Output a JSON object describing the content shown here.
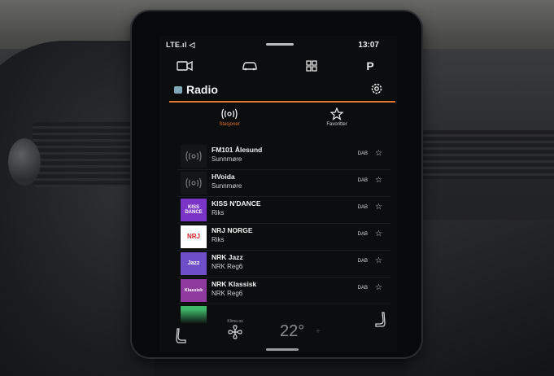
{
  "status": {
    "signal": "LTE.ıl ◁",
    "time": "13:07"
  },
  "topnav": [
    {
      "name": "camera-icon"
    },
    {
      "name": "car-icon"
    },
    {
      "name": "apps-grid-icon"
    },
    {
      "name": "parking-icon",
      "label": "P"
    }
  ],
  "app": {
    "title": "Radio",
    "accent": "#e0742c"
  },
  "tabs": {
    "stations": "Stasjoner",
    "favorites": "Favoritter"
  },
  "stations": [
    {
      "name": "FM101 Ålesund",
      "region": "Sunnmøre",
      "band": "DAB",
      "logo": "generic-radio-icon"
    },
    {
      "name": "HVoida",
      "region": "Sunnmøre",
      "band": "DAB",
      "logo": "generic-radio-icon"
    },
    {
      "name": "KISS N'DANCE",
      "region": "Riks",
      "band": "DAB",
      "logo": "kiss-logo",
      "logo_color": "#7b35c6",
      "logo_text": "KISS DANCE"
    },
    {
      "name": "NRJ NORGE",
      "region": "Riks",
      "band": "DAB",
      "logo": "nrj-logo",
      "logo_color": "#ffffff",
      "logo_text": "NRJ"
    },
    {
      "name": "NRK Jazz",
      "region": "NRK Reg6",
      "band": "DAB",
      "logo": "nrk-jazz-logo",
      "logo_color": "#6f4fc7",
      "logo_text": "Jazz"
    },
    {
      "name": "NRK Klassisk",
      "region": "NRK Reg6",
      "band": "DAB",
      "logo": "nrk-klassisk-logo",
      "logo_color": "#8e3a9f",
      "logo_text": "Klassisk"
    }
  ],
  "climate": {
    "fan_label": "Klima av",
    "temperature": "22°"
  }
}
